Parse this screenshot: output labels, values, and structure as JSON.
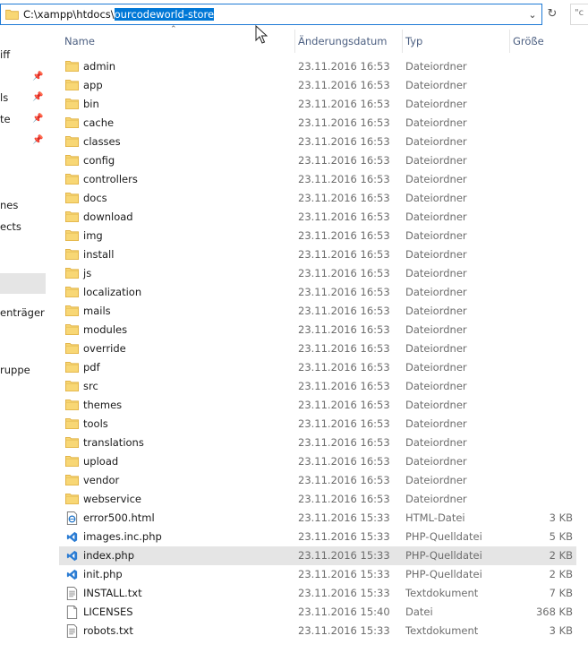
{
  "address": {
    "path_prefix": "C:\\xampp\\htdocs\\",
    "path_selected": "ourcodeworld-store",
    "search_placeholder": "\"c"
  },
  "nav": {
    "items": [
      {
        "label": "iff",
        "pinned": false
      },
      {
        "label": "ls",
        "pinned": true
      },
      {
        "label": "te",
        "pinned": true
      },
      {
        "label": "",
        "pinned": true
      },
      {
        "label": "nes",
        "pinned": false
      },
      {
        "label": "ects",
        "pinned": false
      },
      {
        "label": "enträger (",
        "pinned": false
      },
      {
        "label": "ruppe",
        "pinned": false
      }
    ]
  },
  "columns": {
    "name": "Name",
    "date": "Änderungsdatum",
    "type": "Typ",
    "size": "Größe"
  },
  "files": [
    {
      "name": "admin",
      "date": "23.11.2016 16:53",
      "type": "Dateiordner",
      "size": "",
      "icon": "folder-icon"
    },
    {
      "name": "app",
      "date": "23.11.2016 16:53",
      "type": "Dateiordner",
      "size": "",
      "icon": "folder-icon"
    },
    {
      "name": "bin",
      "date": "23.11.2016 16:53",
      "type": "Dateiordner",
      "size": "",
      "icon": "folder-icon"
    },
    {
      "name": "cache",
      "date": "23.11.2016 16:53",
      "type": "Dateiordner",
      "size": "",
      "icon": "folder-icon"
    },
    {
      "name": "classes",
      "date": "23.11.2016 16:53",
      "type": "Dateiordner",
      "size": "",
      "icon": "folder-icon"
    },
    {
      "name": "config",
      "date": "23.11.2016 16:53",
      "type": "Dateiordner",
      "size": "",
      "icon": "folder-icon"
    },
    {
      "name": "controllers",
      "date": "23.11.2016 16:53",
      "type": "Dateiordner",
      "size": "",
      "icon": "folder-icon"
    },
    {
      "name": "docs",
      "date": "23.11.2016 16:53",
      "type": "Dateiordner",
      "size": "",
      "icon": "folder-icon"
    },
    {
      "name": "download",
      "date": "23.11.2016 16:53",
      "type": "Dateiordner",
      "size": "",
      "icon": "folder-icon"
    },
    {
      "name": "img",
      "date": "23.11.2016 16:53",
      "type": "Dateiordner",
      "size": "",
      "icon": "folder-icon"
    },
    {
      "name": "install",
      "date": "23.11.2016 16:53",
      "type": "Dateiordner",
      "size": "",
      "icon": "folder-icon"
    },
    {
      "name": "js",
      "date": "23.11.2016 16:53",
      "type": "Dateiordner",
      "size": "",
      "icon": "folder-icon"
    },
    {
      "name": "localization",
      "date": "23.11.2016 16:53",
      "type": "Dateiordner",
      "size": "",
      "icon": "folder-icon"
    },
    {
      "name": "mails",
      "date": "23.11.2016 16:53",
      "type": "Dateiordner",
      "size": "",
      "icon": "folder-icon"
    },
    {
      "name": "modules",
      "date": "23.11.2016 16:53",
      "type": "Dateiordner",
      "size": "",
      "icon": "folder-icon"
    },
    {
      "name": "override",
      "date": "23.11.2016 16:53",
      "type": "Dateiordner",
      "size": "",
      "icon": "folder-icon"
    },
    {
      "name": "pdf",
      "date": "23.11.2016 16:53",
      "type": "Dateiordner",
      "size": "",
      "icon": "folder-icon"
    },
    {
      "name": "src",
      "date": "23.11.2016 16:53",
      "type": "Dateiordner",
      "size": "",
      "icon": "folder-icon"
    },
    {
      "name": "themes",
      "date": "23.11.2016 16:53",
      "type": "Dateiordner",
      "size": "",
      "icon": "folder-icon"
    },
    {
      "name": "tools",
      "date": "23.11.2016 16:53",
      "type": "Dateiordner",
      "size": "",
      "icon": "folder-icon"
    },
    {
      "name": "translations",
      "date": "23.11.2016 16:53",
      "type": "Dateiordner",
      "size": "",
      "icon": "folder-icon"
    },
    {
      "name": "upload",
      "date": "23.11.2016 16:53",
      "type": "Dateiordner",
      "size": "",
      "icon": "folder-icon"
    },
    {
      "name": "vendor",
      "date": "23.11.2016 16:53",
      "type": "Dateiordner",
      "size": "",
      "icon": "folder-icon"
    },
    {
      "name": "webservice",
      "date": "23.11.2016 16:53",
      "type": "Dateiordner",
      "size": "",
      "icon": "folder-icon"
    },
    {
      "name": "error500.html",
      "date": "23.11.2016 15:33",
      "type": "HTML-Datei",
      "size": "3 KB",
      "icon": "html-file-icon"
    },
    {
      "name": "images.inc.php",
      "date": "23.11.2016 15:33",
      "type": "PHP-Quelldatei",
      "size": "5 KB",
      "icon": "php-file-icon"
    },
    {
      "name": "index.php",
      "date": "23.11.2016 15:33",
      "type": "PHP-Quelldatei",
      "size": "2 KB",
      "icon": "php-file-icon",
      "selected": true
    },
    {
      "name": "init.php",
      "date": "23.11.2016 15:33",
      "type": "PHP-Quelldatei",
      "size": "2 KB",
      "icon": "php-file-icon"
    },
    {
      "name": "INSTALL.txt",
      "date": "23.11.2016 15:33",
      "type": "Textdokument",
      "size": "7 KB",
      "icon": "text-file-icon"
    },
    {
      "name": "LICENSES",
      "date": "23.11.2016 15:40",
      "type": "Datei",
      "size": "368 KB",
      "icon": "blank-file-icon"
    },
    {
      "name": "robots.txt",
      "date": "23.11.2016 15:33",
      "type": "Textdokument",
      "size": "3 KB",
      "icon": "text-file-icon"
    }
  ],
  "colors": {
    "selection": "#0078d7",
    "row_selected": "#e5e5e5",
    "folder": "#f8d775",
    "header_text": "#4d6082"
  }
}
